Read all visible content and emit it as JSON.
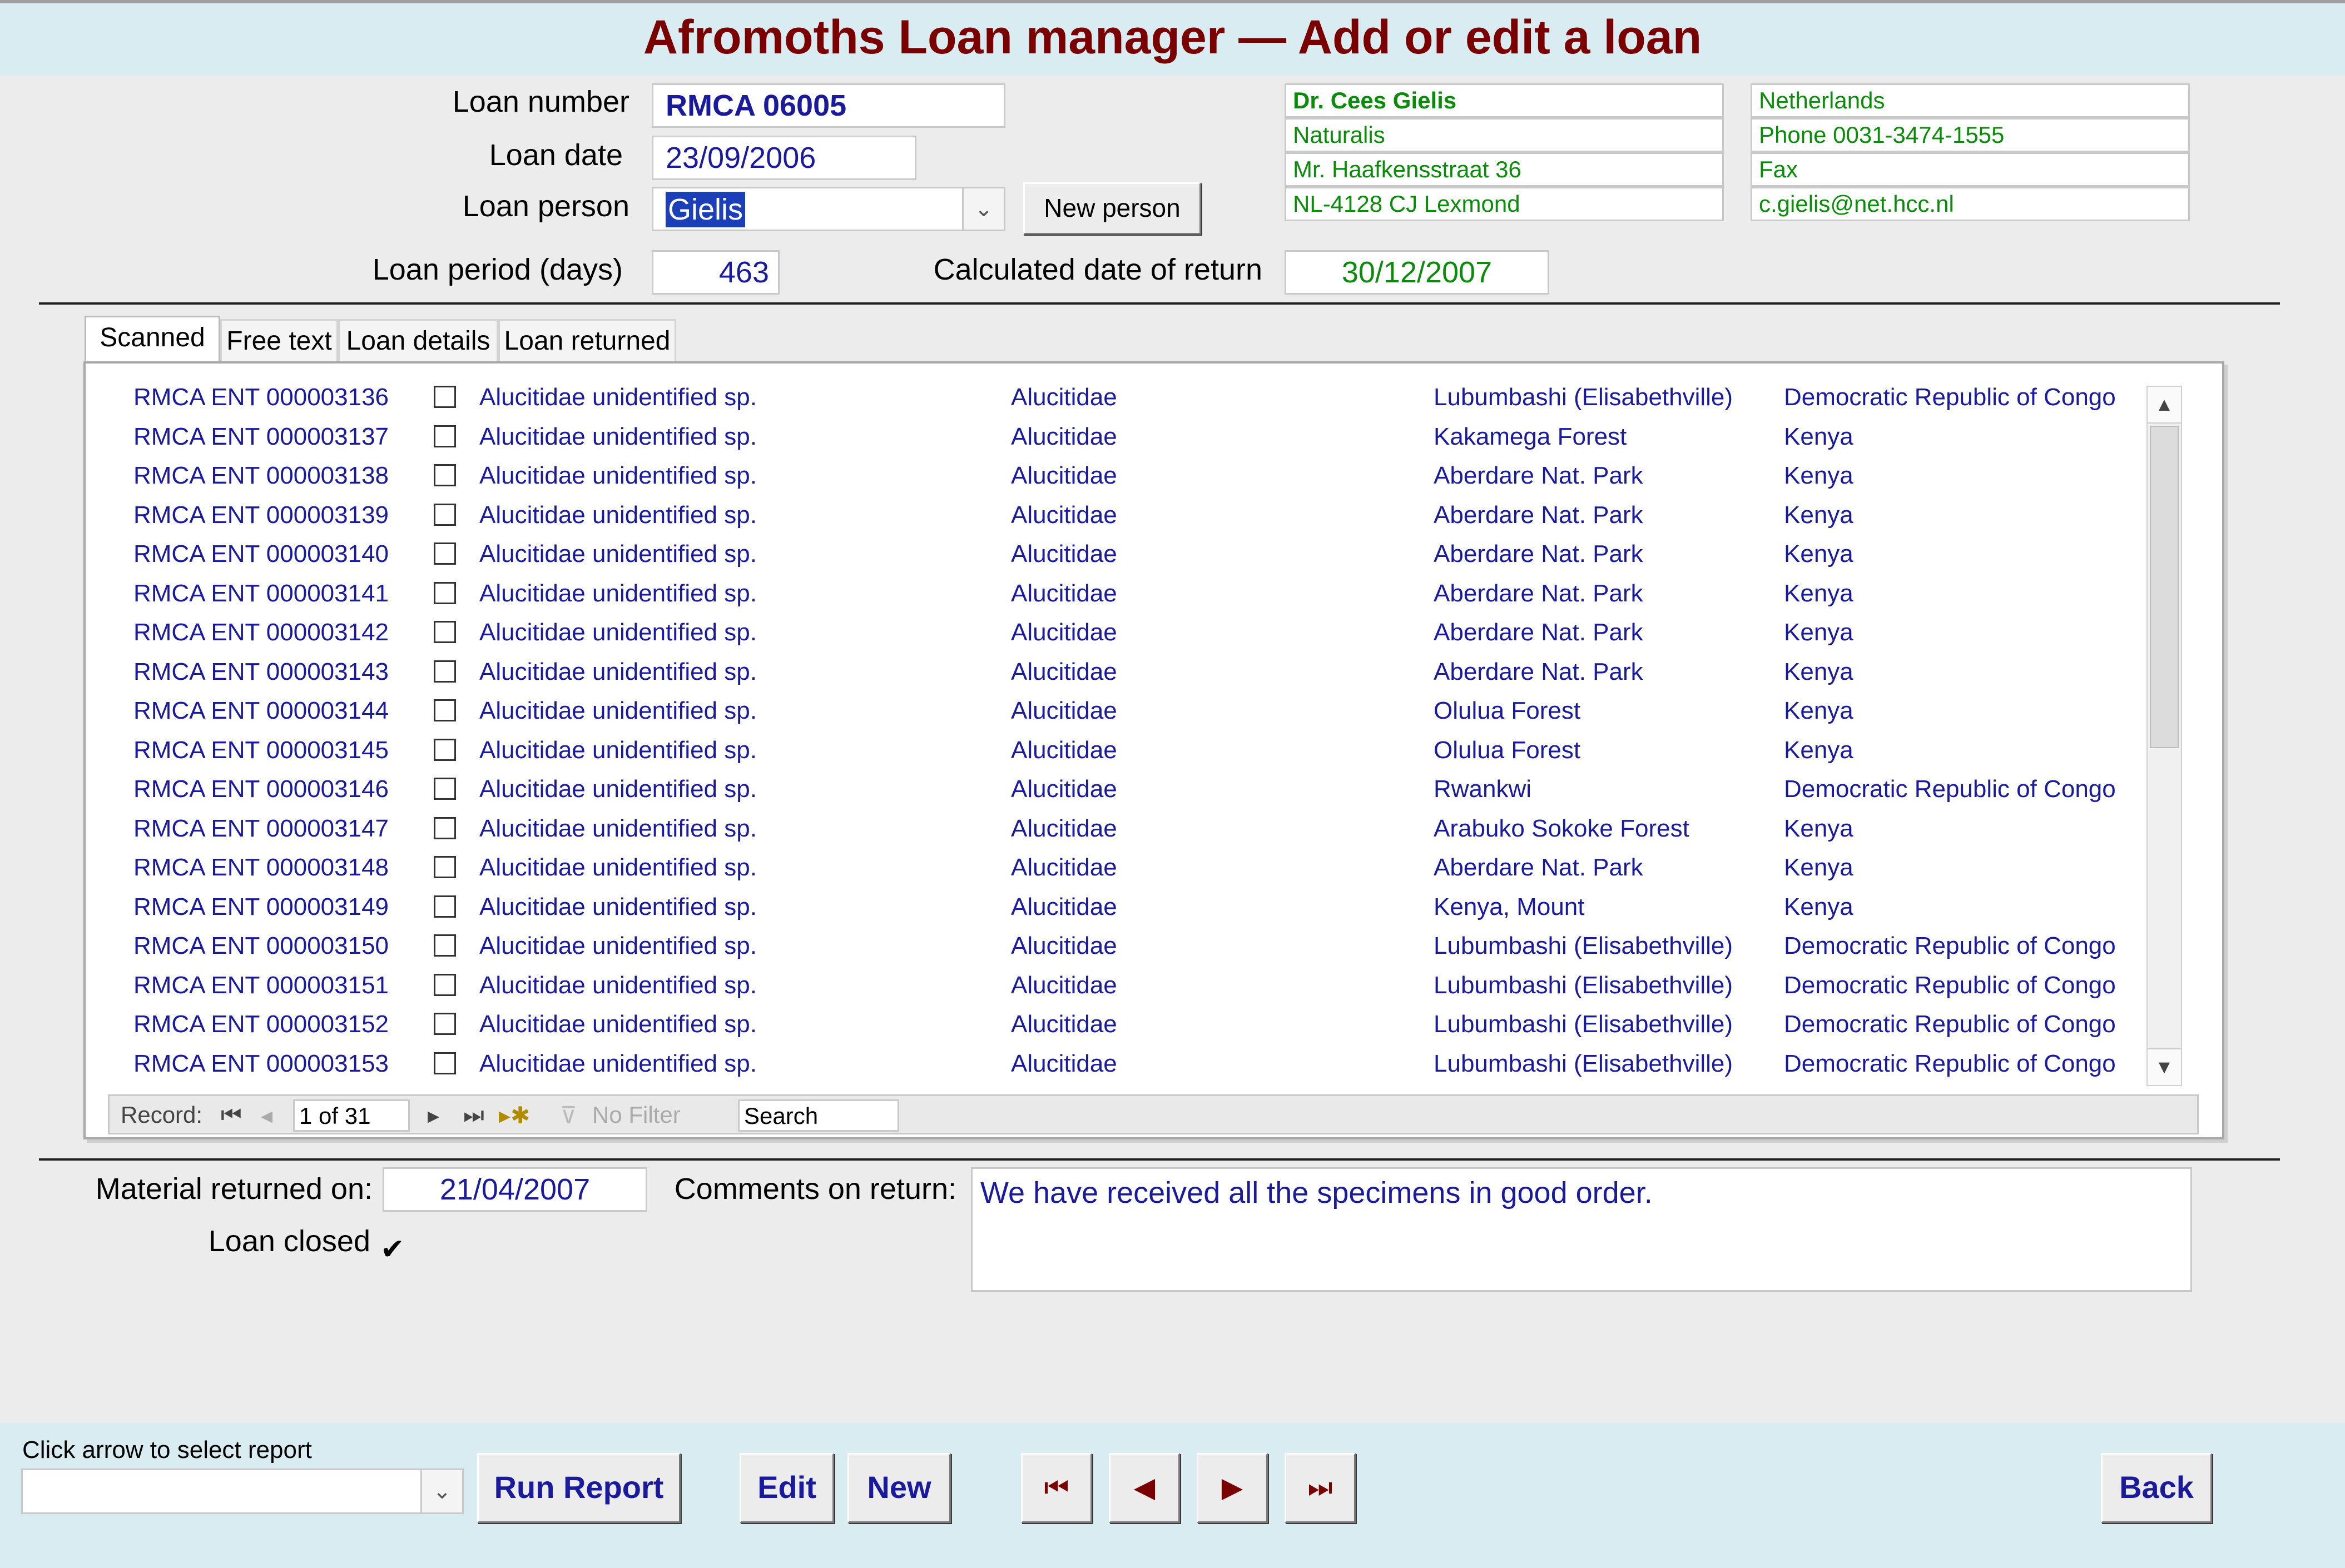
{
  "title": "Afromoths Loan manager — Add or edit a loan",
  "form": {
    "loan_number_label": "Loan number",
    "loan_number": "RMCA 06005",
    "loan_date_label": "Loan date",
    "loan_date": "23/09/2006",
    "loan_person_label": "Loan person",
    "loan_person": "Gielis",
    "new_person_label": "New person",
    "loan_period_label": "Loan period (days)",
    "loan_period": "463",
    "calc_return_label": "Calculated date of return",
    "calc_return": "30/12/2007"
  },
  "contact": {
    "name": "Dr. Cees Gielis",
    "institution": "Naturalis",
    "street": "Mr. Haafkensstraat 36",
    "city": "NL-4128 CJ Lexmond",
    "country": "Netherlands",
    "phone": "Phone 0031-3474-1555",
    "fax": "Fax",
    "email": "c.gielis@net.hcc.nl"
  },
  "tabs": [
    "Scanned",
    "Free text",
    "Loan details",
    "Loan returned"
  ],
  "records": [
    {
      "id": "RMCA ENT 000003136",
      "taxon": "Alucitidae unidentified sp.",
      "family": "Alucitidae",
      "locality": "Lubumbashi (Elisabethville)",
      "country": "Democratic Republic of Congo"
    },
    {
      "id": "RMCA ENT 000003137",
      "taxon": "Alucitidae unidentified sp.",
      "family": "Alucitidae",
      "locality": "Kakamega Forest",
      "country": "Kenya"
    },
    {
      "id": "RMCA ENT 000003138",
      "taxon": "Alucitidae unidentified sp.",
      "family": "Alucitidae",
      "locality": "Aberdare Nat. Park",
      "country": "Kenya"
    },
    {
      "id": "RMCA ENT 000003139",
      "taxon": "Alucitidae unidentified sp.",
      "family": "Alucitidae",
      "locality": "Aberdare Nat. Park",
      "country": "Kenya"
    },
    {
      "id": "RMCA ENT 000003140",
      "taxon": "Alucitidae unidentified sp.",
      "family": "Alucitidae",
      "locality": "Aberdare Nat. Park",
      "country": "Kenya"
    },
    {
      "id": "RMCA ENT 000003141",
      "taxon": "Alucitidae unidentified sp.",
      "family": "Alucitidae",
      "locality": "Aberdare Nat. Park",
      "country": "Kenya"
    },
    {
      "id": "RMCA ENT 000003142",
      "taxon": "Alucitidae unidentified sp.",
      "family": "Alucitidae",
      "locality": "Aberdare Nat. Park",
      "country": "Kenya"
    },
    {
      "id": "RMCA ENT 000003143",
      "taxon": "Alucitidae unidentified sp.",
      "family": "Alucitidae",
      "locality": "Aberdare Nat. Park",
      "country": "Kenya"
    },
    {
      "id": "RMCA ENT 000003144",
      "taxon": "Alucitidae unidentified sp.",
      "family": "Alucitidae",
      "locality": "Olulua Forest",
      "country": "Kenya"
    },
    {
      "id": "RMCA ENT 000003145",
      "taxon": "Alucitidae unidentified sp.",
      "family": "Alucitidae",
      "locality": "Olulua Forest",
      "country": "Kenya"
    },
    {
      "id": "RMCA ENT 000003146",
      "taxon": "Alucitidae unidentified sp.",
      "family": "Alucitidae",
      "locality": "Rwankwi",
      "country": "Democratic Republic of Congo"
    },
    {
      "id": "RMCA ENT 000003147",
      "taxon": "Alucitidae unidentified sp.",
      "family": "Alucitidae",
      "locality": "Arabuko Sokoke Forest",
      "country": "Kenya"
    },
    {
      "id": "RMCA ENT 000003148",
      "taxon": "Alucitidae unidentified sp.",
      "family": "Alucitidae",
      "locality": "Aberdare Nat. Park",
      "country": "Kenya"
    },
    {
      "id": "RMCA ENT 000003149",
      "taxon": "Alucitidae unidentified sp.",
      "family": "Alucitidae",
      "locality": "Kenya, Mount",
      "country": "Kenya"
    },
    {
      "id": "RMCA ENT 000003150",
      "taxon": "Alucitidae unidentified sp.",
      "family": "Alucitidae",
      "locality": "Lubumbashi (Elisabethville)",
      "country": "Democratic Republic of Congo"
    },
    {
      "id": "RMCA ENT 000003151",
      "taxon": "Alucitidae unidentified sp.",
      "family": "Alucitidae",
      "locality": "Lubumbashi (Elisabethville)",
      "country": "Democratic Republic of Congo"
    },
    {
      "id": "RMCA ENT 000003152",
      "taxon": "Alucitidae unidentified sp.",
      "family": "Alucitidae",
      "locality": "Lubumbashi (Elisabethville)",
      "country": "Democratic Republic of Congo"
    },
    {
      "id": "RMCA ENT 000003153",
      "taxon": "Alucitidae unidentified sp.",
      "family": "Alucitidae",
      "locality": "Lubumbashi (Elisabethville)",
      "country": "Democratic Republic of Congo"
    }
  ],
  "record_nav": {
    "record_label": "Record:",
    "position": "1 of 31",
    "no_filter": "No Filter",
    "search_placeholder": "Search"
  },
  "return": {
    "returned_on_label": "Material returned on:",
    "returned_on": "21/04/2007",
    "comments_label": "Comments on return:",
    "comments": "We have received all the specimens in good order.",
    "loan_closed_label": "Loan closed",
    "loan_closed": true
  },
  "footer": {
    "report_hint": "Click arrow to select report",
    "run_report": "Run Report",
    "edit": "Edit",
    "new": "New",
    "first": "⏮",
    "prev": "◀",
    "next": "▶",
    "last": "⏭",
    "back": "Back"
  },
  "colors": {
    "title": "#7a0000",
    "data_text": "#1a1a9c",
    "contact_text": "#0a8c0a",
    "banner": "#d9ecf2"
  }
}
